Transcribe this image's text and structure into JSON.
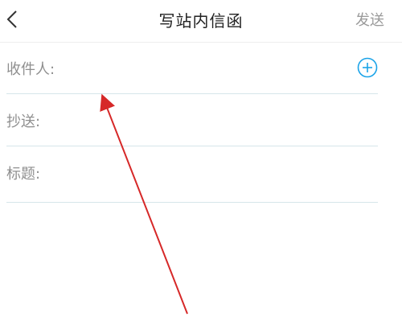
{
  "header": {
    "back_icon": "chevron-left-icon",
    "title": "写站内信函",
    "send_label": "发送"
  },
  "form": {
    "recipient_label": "收件人:",
    "add_recipient_icon": "plus-circle-icon",
    "cc_label": "抄送:",
    "subject_label": "标题:"
  },
  "colors": {
    "accent": "#1aa3e8",
    "divider": "#d6e6ea",
    "label": "#8f8f8f",
    "annotation_arrow": "#d62828"
  }
}
